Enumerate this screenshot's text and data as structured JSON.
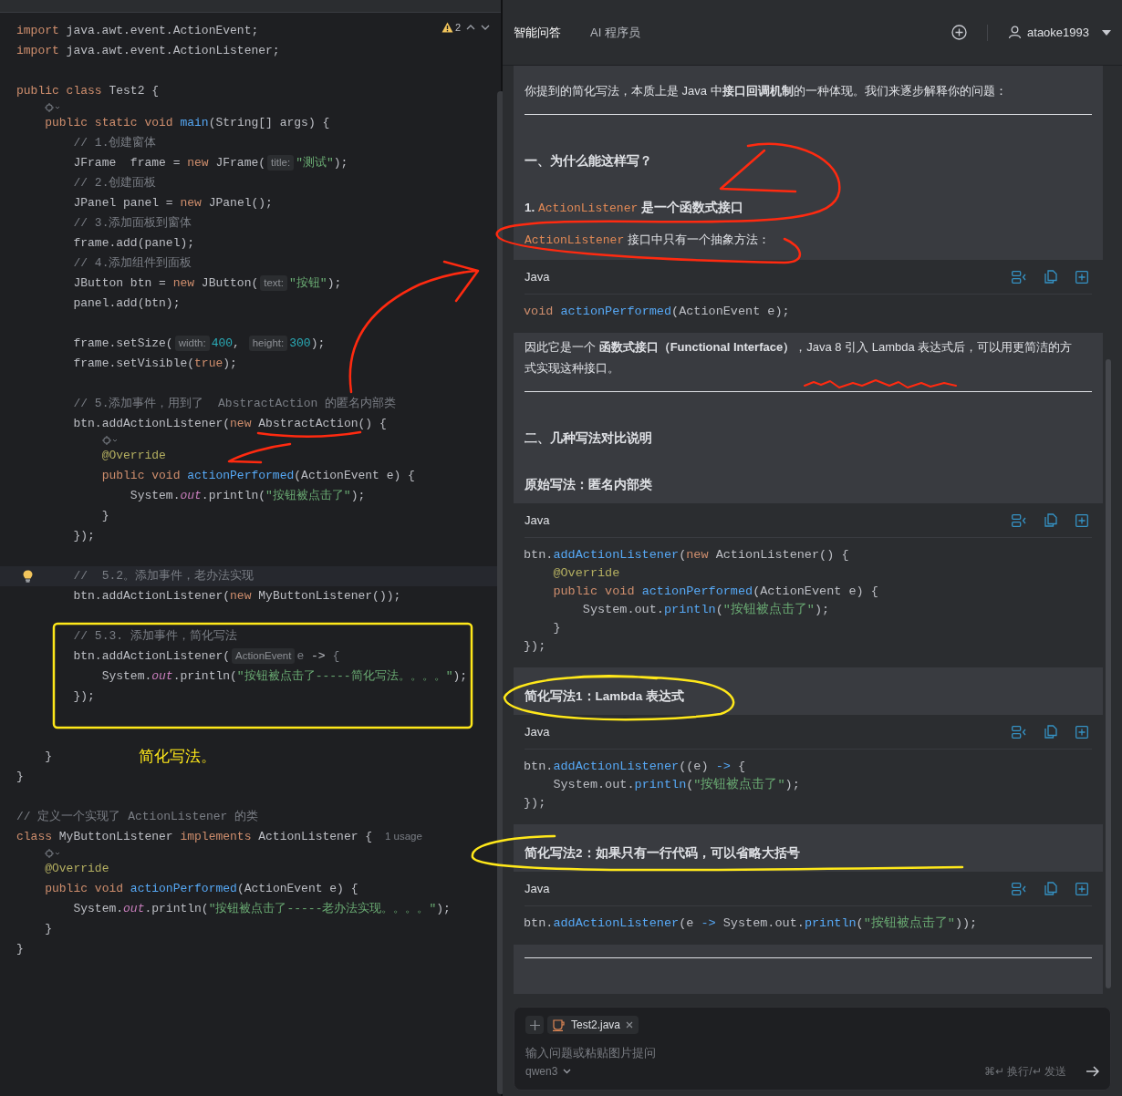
{
  "editor": {
    "warning_count": "2",
    "lines": [
      {
        "kind": "code",
        "current": false,
        "tokens": [
          {
            "kind": "keyword",
            "text": "import "
          },
          {
            "kind": "plain",
            "text": "java.awt.event.ActionEvent;"
          }
        ]
      },
      {
        "kind": "code",
        "current": false,
        "tokens": [
          {
            "kind": "keyword",
            "text": "import "
          },
          {
            "kind": "plain",
            "text": "java.awt.event.ActionListener;"
          }
        ]
      },
      {
        "kind": "blank",
        "current": false
      },
      {
        "kind": "code",
        "current": false,
        "tokens": [
          {
            "kind": "keyword",
            "text": "public class "
          },
          {
            "kind": "plain",
            "text": "Test2 {"
          }
        ]
      },
      {
        "kind": "inlay",
        "current": false
      },
      {
        "kind": "code",
        "current": false,
        "tokens": [
          {
            "kind": "keyword",
            "text": "    public static void "
          },
          {
            "kind": "function",
            "text": "main"
          },
          {
            "kind": "plain",
            "text": "(String[] args) {"
          }
        ]
      },
      {
        "kind": "code",
        "current": false,
        "tokens": [
          {
            "kind": "comment",
            "text": "        // 1.创建窗体"
          }
        ]
      },
      {
        "kind": "code",
        "current": false,
        "tokens": [
          {
            "kind": "plain",
            "text": "        JFrame  frame = "
          },
          {
            "kind": "keyword",
            "text": "new "
          },
          {
            "kind": "plain",
            "text": "JFrame("
          },
          {
            "kind": "hint",
            "text": "title:"
          },
          {
            "kind": "string",
            "text": "\"测试\""
          },
          {
            "kind": "plain",
            "text": ");"
          }
        ]
      },
      {
        "kind": "code",
        "current": false,
        "tokens": [
          {
            "kind": "comment",
            "text": "        // 2.创建面板"
          }
        ]
      },
      {
        "kind": "code",
        "current": false,
        "tokens": [
          {
            "kind": "plain",
            "text": "        JPanel panel = "
          },
          {
            "kind": "keyword",
            "text": "new "
          },
          {
            "kind": "plain",
            "text": "JPanel();"
          }
        ]
      },
      {
        "kind": "code",
        "current": false,
        "tokens": [
          {
            "kind": "comment",
            "text": "        // 3.添加面板到窗体"
          }
        ]
      },
      {
        "kind": "code",
        "current": false,
        "tokens": [
          {
            "kind": "plain",
            "text": "        frame.add(panel);"
          }
        ]
      },
      {
        "kind": "code",
        "current": false,
        "tokens": [
          {
            "kind": "comment",
            "text": "        // 4.添加组件到面板"
          }
        ]
      },
      {
        "kind": "code",
        "current": false,
        "tokens": [
          {
            "kind": "plain",
            "text": "        JButton btn = "
          },
          {
            "kind": "keyword",
            "text": "new "
          },
          {
            "kind": "plain",
            "text": "JButton("
          },
          {
            "kind": "hint",
            "text": "text:"
          },
          {
            "kind": "string",
            "text": "\"按钮\""
          },
          {
            "kind": "plain",
            "text": ");"
          }
        ]
      },
      {
        "kind": "code",
        "current": false,
        "tokens": [
          {
            "kind": "plain",
            "text": "        panel.add(btn);"
          }
        ]
      },
      {
        "kind": "blank",
        "current": false
      },
      {
        "kind": "code",
        "current": false,
        "tokens": [
          {
            "kind": "plain",
            "text": "        frame.setSize("
          },
          {
            "kind": "hint",
            "text": "width:"
          },
          {
            "kind": "number",
            "text": "400"
          },
          {
            "kind": "plain",
            "text": ", "
          },
          {
            "kind": "hint",
            "text": "height:"
          },
          {
            "kind": "number",
            "text": "300"
          },
          {
            "kind": "plain",
            "text": ");"
          }
        ]
      },
      {
        "kind": "code",
        "current": false,
        "tokens": [
          {
            "kind": "plain",
            "text": "        frame.setVisible("
          },
          {
            "kind": "keyword",
            "text": "true"
          },
          {
            "kind": "plain",
            "text": ");"
          }
        ]
      },
      {
        "kind": "blank",
        "current": false
      },
      {
        "kind": "code",
        "current": false,
        "tokens": [
          {
            "kind": "comment",
            "text": "        // 5.添加事件，用到了  AbstractAction 的匿名内部类"
          }
        ]
      },
      {
        "kind": "code",
        "current": false,
        "tokens": [
          {
            "kind": "plain",
            "text": "        btn.addActionListener("
          },
          {
            "kind": "keyword",
            "text": "new "
          },
          {
            "kind": "plain",
            "text": "AbstractAction() {"
          }
        ]
      },
      {
        "kind": "inlay",
        "current": false
      },
      {
        "kind": "code",
        "current": false,
        "tokens": [
          {
            "kind": "annotation",
            "text": "            @Override"
          }
        ]
      },
      {
        "kind": "code",
        "current": false,
        "tokens": [
          {
            "kind": "keyword",
            "text": "            public void "
          },
          {
            "kind": "function",
            "text": "actionPerformed"
          },
          {
            "kind": "plain",
            "text": "(ActionEvent e) {"
          }
        ]
      },
      {
        "kind": "code",
        "current": false,
        "tokens": [
          {
            "kind": "plain",
            "text": "                System."
          },
          {
            "kind": "field",
            "text": "out"
          },
          {
            "kind": "plain",
            "text": ".println("
          },
          {
            "kind": "string",
            "text": "\"按钮被点击了\""
          },
          {
            "kind": "plain",
            "text": ");"
          }
        ]
      },
      {
        "kind": "code",
        "current": false,
        "tokens": [
          {
            "kind": "plain",
            "text": "            }"
          }
        ]
      },
      {
        "kind": "code",
        "current": false,
        "tokens": [
          {
            "kind": "plain",
            "text": "        });"
          }
        ]
      },
      {
        "kind": "blank",
        "current": false
      },
      {
        "kind": "code",
        "current": true,
        "tokens": [
          {
            "kind": "comment",
            "text": "        //  5.2。添加事件，老办法实现"
          }
        ]
      },
      {
        "kind": "code",
        "current": false,
        "tokens": [
          {
            "kind": "plain",
            "text": "        btn.addActionListener("
          },
          {
            "kind": "keyword",
            "text": "new "
          },
          {
            "kind": "plain",
            "text": "MyButtonListener());"
          }
        ]
      },
      {
        "kind": "blank",
        "current": false
      },
      {
        "kind": "code",
        "current": false,
        "tokens": [
          {
            "kind": "comment",
            "text": "        // 5.3. 添加事件，简化写法"
          }
        ]
      },
      {
        "kind": "code",
        "current": false,
        "tokens": [
          {
            "kind": "plain",
            "text": "        btn.addActionListener("
          },
          {
            "kind": "hint",
            "text": "ActionEvent"
          },
          {
            "kind": "comment",
            "text": "e "
          },
          {
            "kind": "plain",
            "text": "-> "
          },
          {
            "kind": "comment",
            "text": "{"
          }
        ]
      },
      {
        "kind": "code",
        "current": false,
        "tokens": [
          {
            "kind": "plain",
            "text": "            System."
          },
          {
            "kind": "field",
            "text": "out"
          },
          {
            "kind": "plain",
            "text": ".println("
          },
          {
            "kind": "string",
            "text": "\"按钮被点击了-----简化写法。。。。\""
          },
          {
            "kind": "plain",
            "text": ");"
          }
        ]
      },
      {
        "kind": "code",
        "current": false,
        "tokens": [
          {
            "kind": "plain",
            "text": "        });"
          }
        ]
      },
      {
        "kind": "blank",
        "current": false
      },
      {
        "kind": "blank",
        "current": false
      },
      {
        "kind": "code",
        "current": false,
        "tokens": [
          {
            "kind": "plain",
            "text": "    }"
          }
        ]
      },
      {
        "kind": "code",
        "current": false,
        "tokens": [
          {
            "kind": "plain",
            "text": "}"
          }
        ]
      },
      {
        "kind": "blank",
        "current": false
      },
      {
        "kind": "code",
        "current": false,
        "tokens": [
          {
            "kind": "comment",
            "text": "// 定义一个实现了 ActionListener 的类"
          }
        ]
      },
      {
        "kind": "code",
        "current": false,
        "tokens": [
          {
            "kind": "keyword",
            "text": "class "
          },
          {
            "kind": "plain",
            "text": "MyButtonListener "
          },
          {
            "kind": "keyword",
            "text": "implements "
          },
          {
            "kind": "plain",
            "text": "ActionListener { "
          },
          {
            "kind": "usage",
            "text": "1 usage"
          }
        ]
      },
      {
        "kind": "inlay",
        "current": false
      },
      {
        "kind": "code",
        "current": false,
        "tokens": [
          {
            "kind": "annotation",
            "text": "    @Override"
          }
        ]
      },
      {
        "kind": "code",
        "current": false,
        "tokens": [
          {
            "kind": "keyword",
            "text": "    public void "
          },
          {
            "kind": "function",
            "text": "actionPerformed"
          },
          {
            "kind": "plain",
            "text": "(ActionEvent e) {"
          }
        ]
      },
      {
        "kind": "code",
        "current": false,
        "tokens": [
          {
            "kind": "plain",
            "text": "        System."
          },
          {
            "kind": "field",
            "text": "out"
          },
          {
            "kind": "plain",
            "text": ".println("
          },
          {
            "kind": "string",
            "text": "\"按钮被点击了-----老办法实现。。。。\""
          },
          {
            "kind": "plain",
            "text": ");"
          }
        ]
      },
      {
        "kind": "code",
        "current": false,
        "tokens": [
          {
            "kind": "plain",
            "text": "    }"
          }
        ]
      },
      {
        "kind": "code",
        "current": false,
        "tokens": [
          {
            "kind": "plain",
            "text": "}"
          }
        ]
      }
    ],
    "note": "简化写法。"
  },
  "assistant": {
    "tabs": [
      {
        "label": "智能问答",
        "selected": true
      },
      {
        "label": "AI 程序员",
        "selected": false
      }
    ],
    "user": "ataoke1993",
    "content": [
      {
        "kind": "paragraph",
        "segments": [
          {
            "kind": "text",
            "text": "你提到的简化写法，本质上是 Java 中"
          },
          {
            "kind": "bold",
            "text": "接口回调机制"
          },
          {
            "kind": "text",
            "text": "的一种体现。我们来逐步解释你的问题："
          }
        ]
      },
      {
        "kind": "rule"
      },
      {
        "kind": "heading",
        "text": "一、为什么能这样写？"
      },
      {
        "kind": "subheading",
        "segments": [
          {
            "kind": "bold",
            "text": "1. "
          },
          {
            "kind": "code",
            "text": "ActionListener"
          },
          {
            "kind": "bold",
            "text": " 是一个函数式接口"
          }
        ]
      },
      {
        "kind": "paragraph",
        "segments": [
          {
            "kind": "code",
            "text": "ActionListener"
          },
          {
            "kind": "text",
            "text": " 接口中只有一个抽象方法："
          }
        ]
      },
      {
        "kind": "code",
        "language": "Java",
        "lines": [
          [
            {
              "kind": "keyword",
              "text": "void "
            },
            {
              "kind": "call",
              "text": "actionPerformed"
            },
            {
              "kind": "plain",
              "text": "(ActionEvent e);"
            }
          ]
        ]
      },
      {
        "kind": "paragraph",
        "segments": [
          {
            "kind": "text",
            "text": "因此它是一个 "
          },
          {
            "kind": "bold",
            "text": "函数式接口（Functional Interface）"
          },
          {
            "kind": "text",
            "text": "，Java 8 引入 Lambda 表达式后，可以用更简洁的方式实现这种接口。"
          }
        ]
      },
      {
        "kind": "rule"
      },
      {
        "kind": "heading",
        "text": "二、几种写法对比说明"
      },
      {
        "kind": "subheading",
        "segments": [
          {
            "kind": "bold",
            "text": "原始写法：匿名内部类"
          }
        ]
      },
      {
        "kind": "code",
        "language": "Java",
        "lines": [
          [
            {
              "kind": "plain",
              "text": "btn."
            },
            {
              "kind": "call",
              "text": "addActionListener"
            },
            {
              "kind": "plain",
              "text": "("
            },
            {
              "kind": "keyword",
              "text": "new "
            },
            {
              "kind": "plain",
              "text": "ActionListener() {"
            }
          ],
          [
            {
              "kind": "annotation",
              "text": "    @Override"
            }
          ],
          [
            {
              "kind": "keyword",
              "text": "    public void "
            },
            {
              "kind": "call",
              "text": "actionPerformed"
            },
            {
              "kind": "plain",
              "text": "(ActionEvent e) {"
            }
          ],
          [
            {
              "kind": "plain",
              "text": "        System.out."
            },
            {
              "kind": "call",
              "text": "println"
            },
            {
              "kind": "plain",
              "text": "("
            },
            {
              "kind": "string",
              "text": "\"按钮被点击了\""
            },
            {
              "kind": "plain",
              "text": ");"
            }
          ],
          [
            {
              "kind": "plain",
              "text": "    }"
            }
          ],
          [
            {
              "kind": "plain",
              "text": "});"
            }
          ]
        ]
      },
      {
        "kind": "subheading",
        "segments": [
          {
            "kind": "bold",
            "text": "简化写法1：Lambda 表达式"
          }
        ]
      },
      {
        "kind": "code",
        "language": "Java",
        "lines": [
          [
            {
              "kind": "plain",
              "text": "btn."
            },
            {
              "kind": "call",
              "text": "addActionListener"
            },
            {
              "kind": "plain",
              "text": "((e) "
            },
            {
              "kind": "call",
              "text": "->"
            },
            {
              "kind": "plain",
              "text": " {"
            }
          ],
          [
            {
              "kind": "plain",
              "text": "    System.out."
            },
            {
              "kind": "call",
              "text": "println"
            },
            {
              "kind": "plain",
              "text": "("
            },
            {
              "kind": "string",
              "text": "\"按钮被点击了\""
            },
            {
              "kind": "plain",
              "text": ");"
            }
          ],
          [
            {
              "kind": "plain",
              "text": "});"
            }
          ]
        ]
      },
      {
        "kind": "subheading",
        "segments": [
          {
            "kind": "bold",
            "text": "简化写法2：如果只有一行代码，可以省略大括号"
          }
        ]
      },
      {
        "kind": "code",
        "language": "Java",
        "lines": [
          [
            {
              "kind": "plain",
              "text": "btn."
            },
            {
              "kind": "call",
              "text": "addActionListener"
            },
            {
              "kind": "plain",
              "text": "(e "
            },
            {
              "kind": "call",
              "text": "->"
            },
            {
              "kind": "plain",
              "text": " System.out."
            },
            {
              "kind": "call",
              "text": "println"
            },
            {
              "kind": "plain",
              "text": "("
            },
            {
              "kind": "string",
              "text": "\"按钮被点击了\""
            },
            {
              "kind": "plain",
              "text": "));"
            }
          ]
        ]
      },
      {
        "kind": "rule"
      }
    ],
    "input": {
      "attachment": "Test2.java",
      "placeholder": "输入问题或粘贴图片提问",
      "model": "qwen3",
      "hint": "⌘↵ 换行/↵ 发送"
    }
  }
}
